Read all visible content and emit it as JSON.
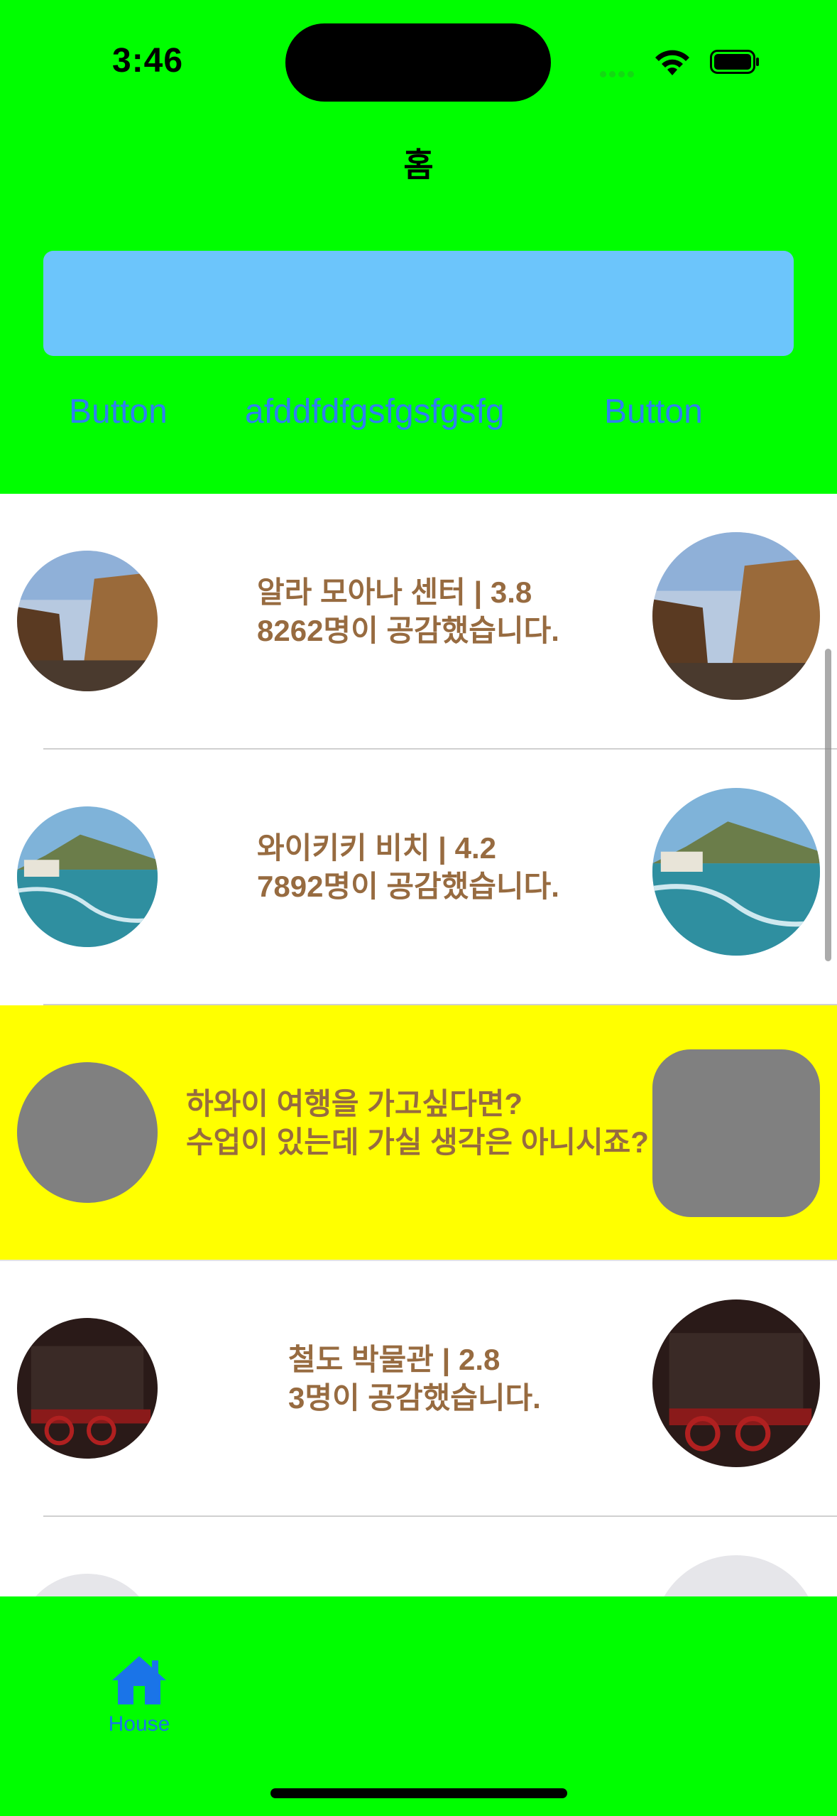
{
  "status_bar": {
    "time": "3:46"
  },
  "nav": {
    "title": "홈"
  },
  "header_buttons": [
    "Button",
    "afddfdfgsfgsfgsfg",
    "Button"
  ],
  "list": [
    {
      "title": "알라 모아나 센터 | 3.8",
      "subtitle": "8262명이 공감했습니다."
    },
    {
      "title": "와이키키 비치 | 4.2",
      "subtitle": "7892명이 공감했습니다."
    },
    {
      "title": "하와이 여행을 가고싶다면?",
      "subtitle": "수업이 있는데 가실 생각은 아니시죠?"
    },
    {
      "title": "철도 박물관 | 2.8",
      "subtitle": "3명이 공감했습니다."
    }
  ],
  "tab_bar": {
    "house_label": "House"
  },
  "colors": {
    "accent": "#00fe00",
    "search_bg": "#6cc5fb",
    "ad_bg": "#ffff00",
    "text_brown": "#976b40",
    "tab_blue": "#1a74e8"
  }
}
